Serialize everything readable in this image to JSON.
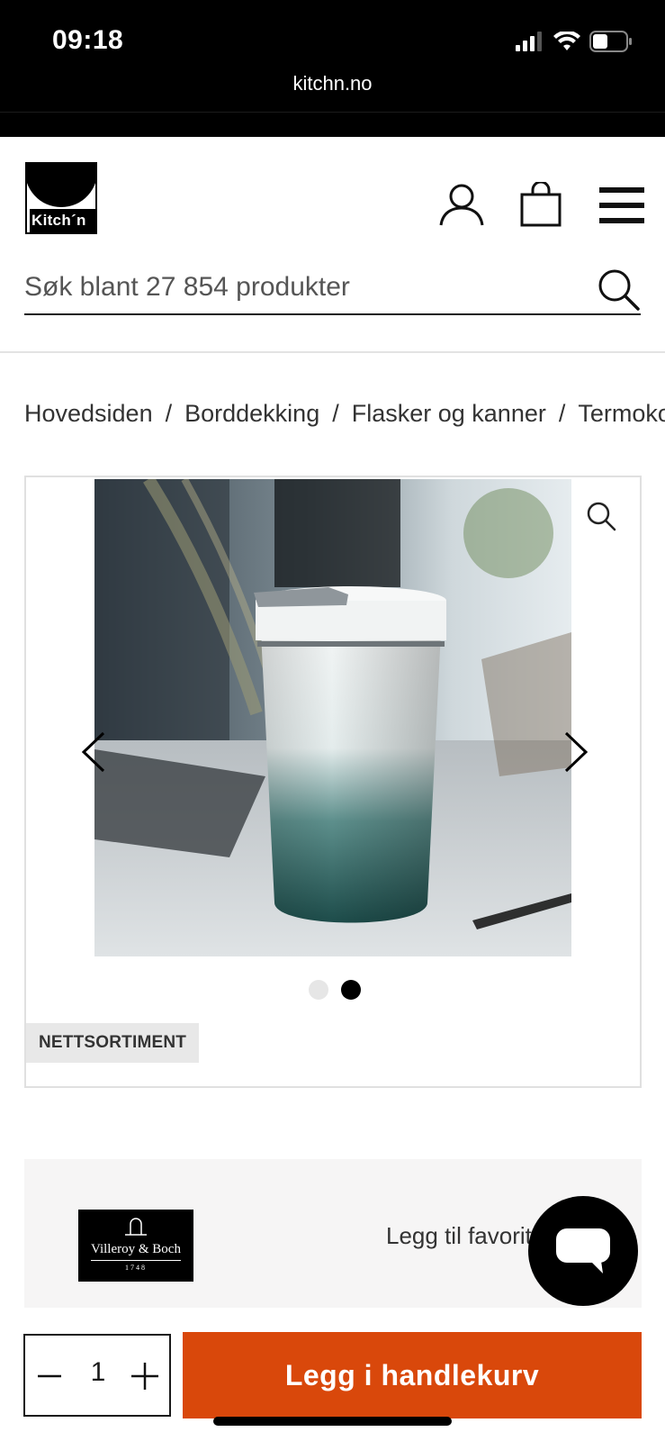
{
  "status_bar": {
    "time": "09:18",
    "url": "kitchn.no",
    "icons": [
      "signal-icon",
      "wifi-icon",
      "battery-icon"
    ]
  },
  "header": {
    "logo_text": "Kitch´n",
    "icons": [
      "user-icon",
      "shopping-bag-icon",
      "hamburger-menu-icon"
    ]
  },
  "search": {
    "placeholder": "Søk blant 27 854 produkter"
  },
  "breadcrumb": {
    "items": [
      "Hovedsiden",
      "Borddekking",
      "Flasker og kanner",
      "Termokopper"
    ],
    "separator": "/"
  },
  "gallery": {
    "image_count": 2,
    "active_index": 1,
    "badge": "NETTSORTIMENT"
  },
  "brand": {
    "name": "Villeroy & Boch",
    "year": "1748",
    "favorite_label": "Legg til favoritter"
  },
  "cart": {
    "quantity": "1",
    "add_label": "Legg i handlekurv"
  },
  "colors": {
    "accent": "#d9480b",
    "badge_bg": "#e8e8e8",
    "brand_strip_bg": "#f6f5f5"
  }
}
